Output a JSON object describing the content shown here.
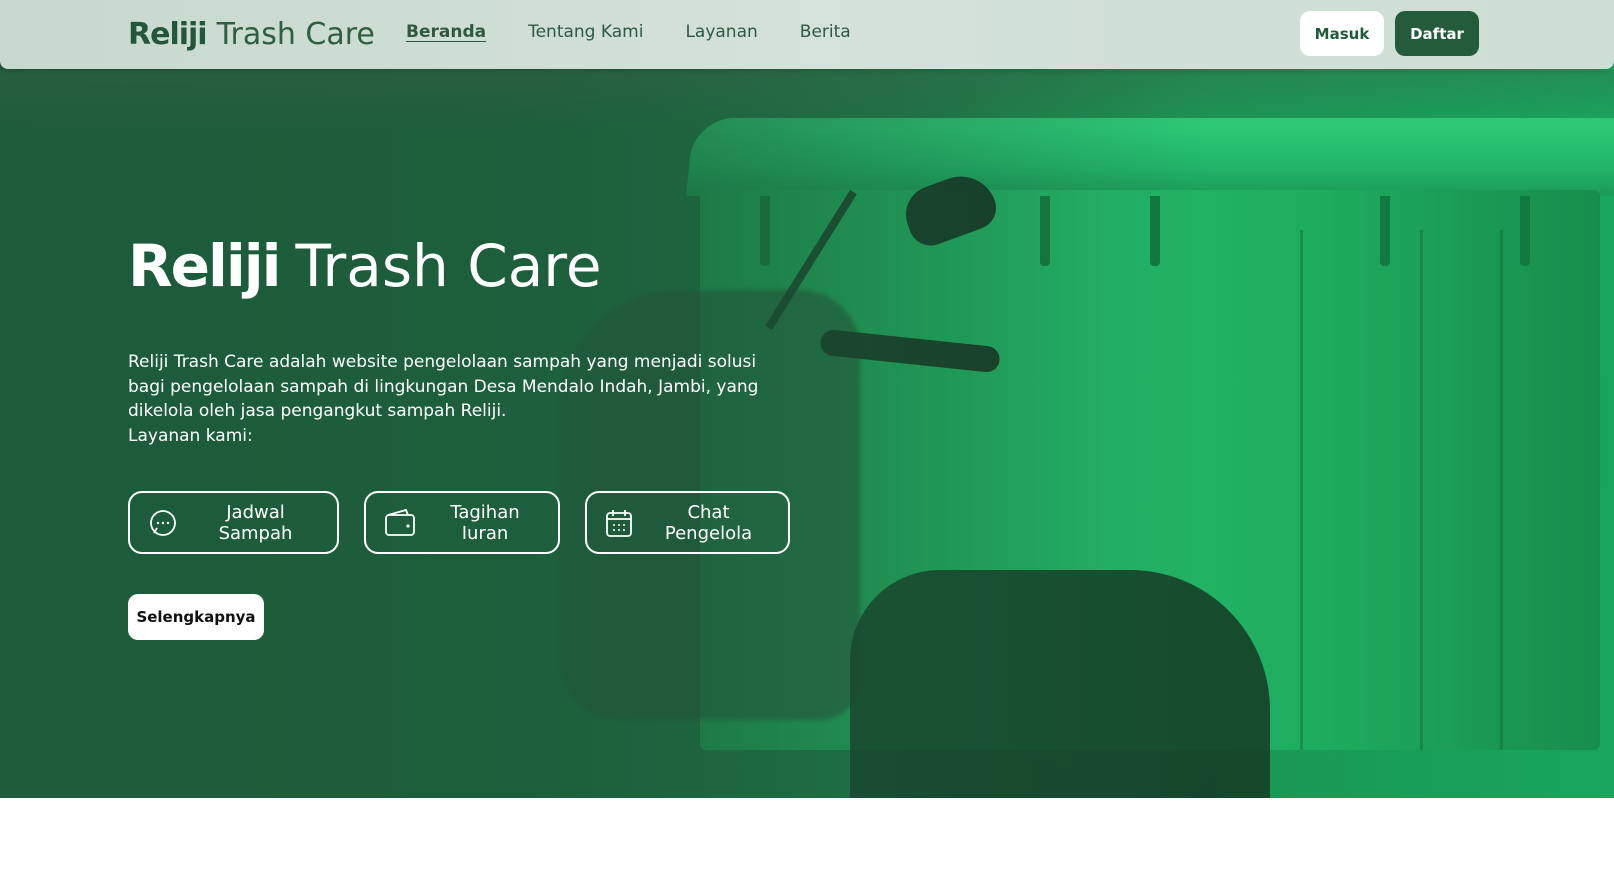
{
  "navbar": {
    "brand_logo": "Reliji",
    "brand_name": "Trash Care",
    "links": [
      {
        "label": "Beranda",
        "active": true
      },
      {
        "label": "Tentang Kami",
        "active": false
      },
      {
        "label": "Layanan",
        "active": false
      },
      {
        "label": "Berita",
        "active": false
      }
    ],
    "login_label": "Masuk",
    "register_label": "Daftar"
  },
  "hero": {
    "title_logo": "Reliji",
    "title_name": "Trash Care",
    "description": "Reliji Trash Care adalah website pengelolaan sampah yang menjadi solusi bagi pengelolaan sampah di lingkungan Desa Mendalo Indah, Jambi, yang dikelola oleh jasa pengangkut sampah Reliji.",
    "services_intro": "Layanan kami:",
    "services": [
      {
        "label": "Jadwal Sampah",
        "icon": "chat-bubble-icon"
      },
      {
        "label": "Tagihan Iuran",
        "icon": "wallet-icon"
      },
      {
        "label": "Chat Pengelola",
        "icon": "calendar-icon"
      }
    ],
    "more_label": "Selengkapnya"
  },
  "colors": {
    "brand_dark_green": "#245c3b",
    "hero_green": "#1d5c3a",
    "bin_green": "#22b669",
    "white": "#ffffff"
  }
}
